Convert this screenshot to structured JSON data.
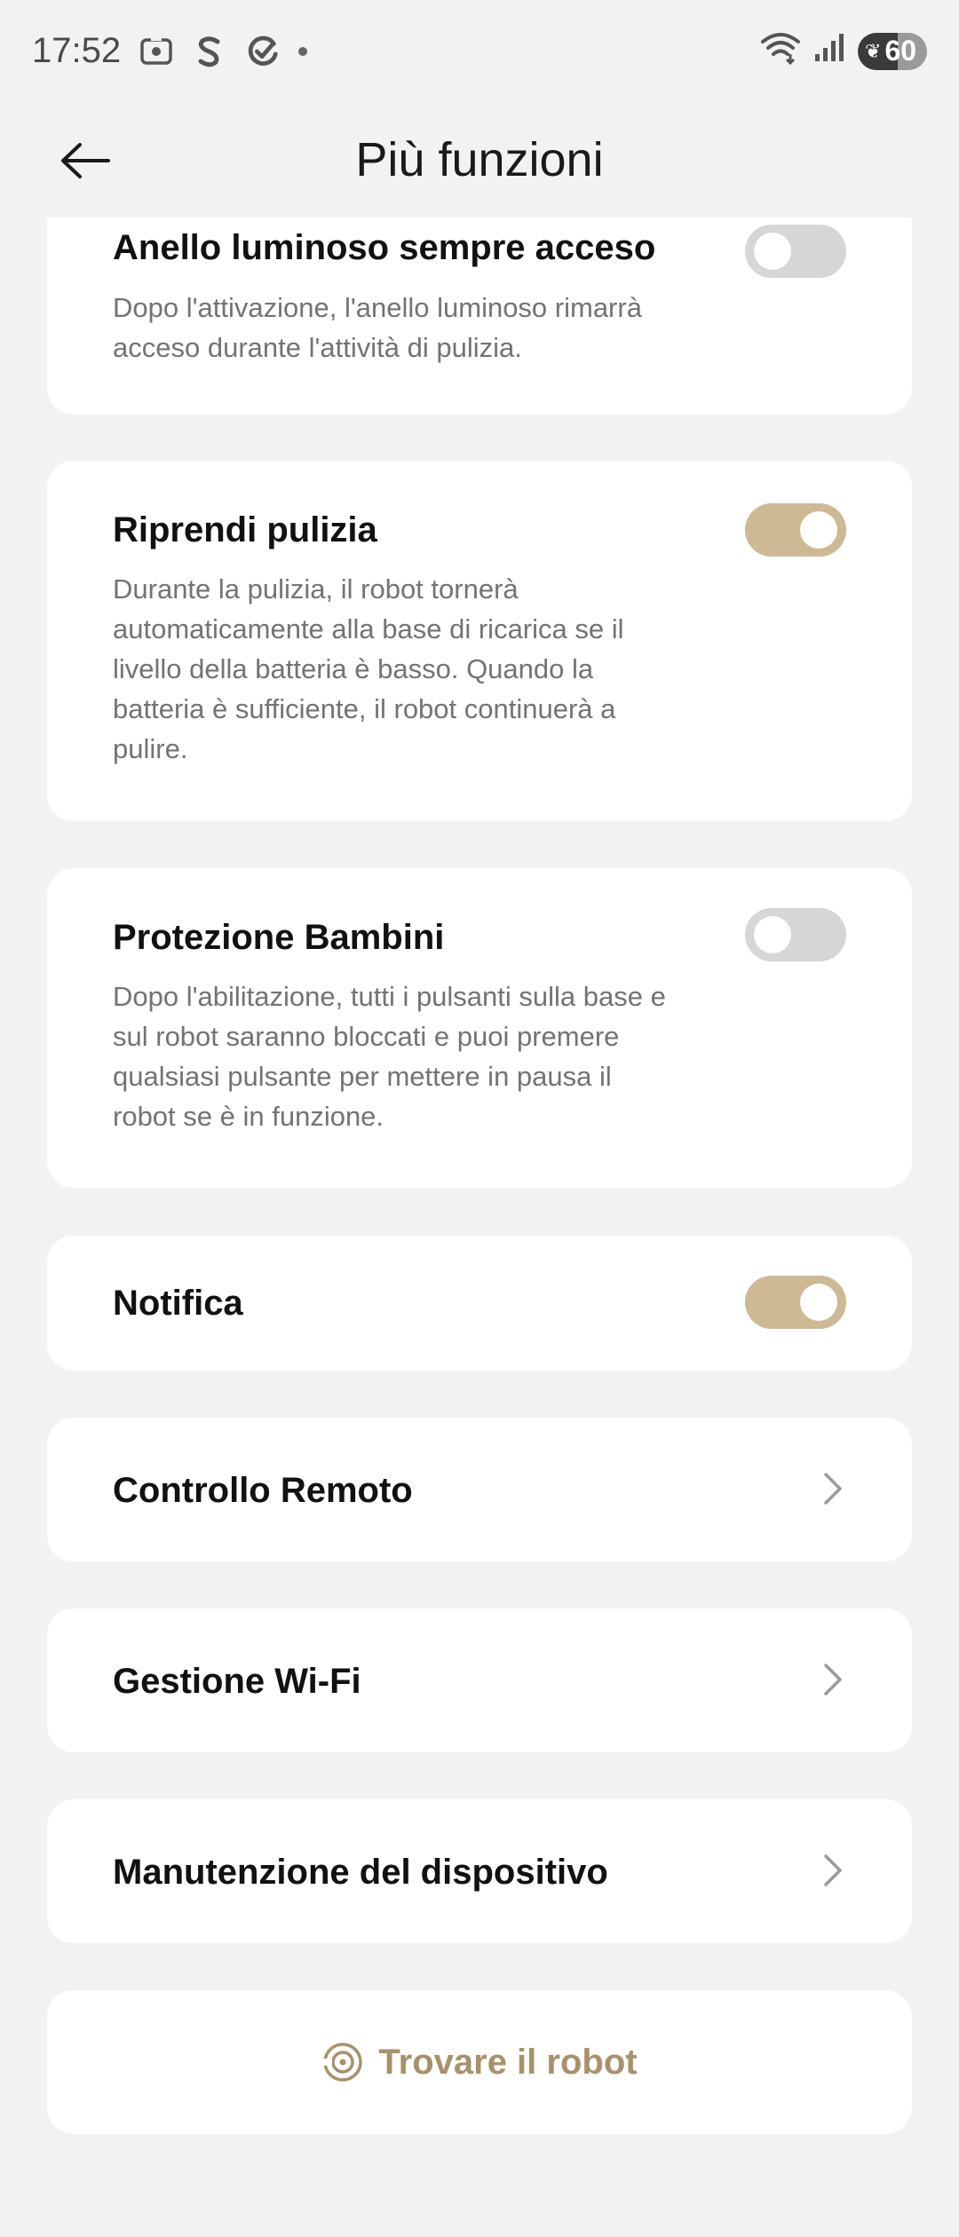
{
  "status_bar": {
    "time": "17:52",
    "battery": "60",
    "icons": [
      "screenshot-icon",
      "s-app-icon",
      "sync-icon",
      "dot-icon",
      "wifi-icon",
      "signal-icon",
      "battery-icon"
    ]
  },
  "header": {
    "title": "Più funzioni",
    "back_icon": "arrow-left-icon"
  },
  "settings": [
    {
      "title": "Anello luminoso sempre acceso",
      "description": "Dopo l'attivazione, l'anello luminoso rimarrà acceso durante l'attività di pulizia.",
      "toggle": "off"
    },
    {
      "title": "Riprendi pulizia",
      "description": "Durante la pulizia, il robot tornerà automaticamente alla base di ricarica se il livello della batteria è basso. Quando la batteria è sufficiente, il robot continuerà a pulire.",
      "toggle": "on"
    },
    {
      "title": "Protezione Bambini",
      "description": "Dopo l'abilitazione, tutti i pulsanti sulla base e sul robot saranno bloccati e puoi premere qualsiasi pulsante per mettere in pausa il robot se è in funzione.",
      "toggle": "off"
    },
    {
      "title": "Notifica",
      "toggle": "on"
    }
  ],
  "nav_items": [
    {
      "label": "Controllo Remoto",
      "icon": "chevron-right-icon"
    },
    {
      "label": "Gestione Wi-Fi",
      "icon": "chevron-right-icon"
    },
    {
      "label": "Manutenzione del dispositivo",
      "icon": "chevron-right-icon"
    }
  ],
  "find_robot": {
    "label": "Trovare il robot",
    "icon": "locate-icon"
  },
  "colors": {
    "background": "#f2f2f2",
    "card": "#ffffff",
    "toggle_on": "#cdb994",
    "toggle_off": "#d6d6d6",
    "accent_text": "#a8916a",
    "description_text": "#737373"
  }
}
